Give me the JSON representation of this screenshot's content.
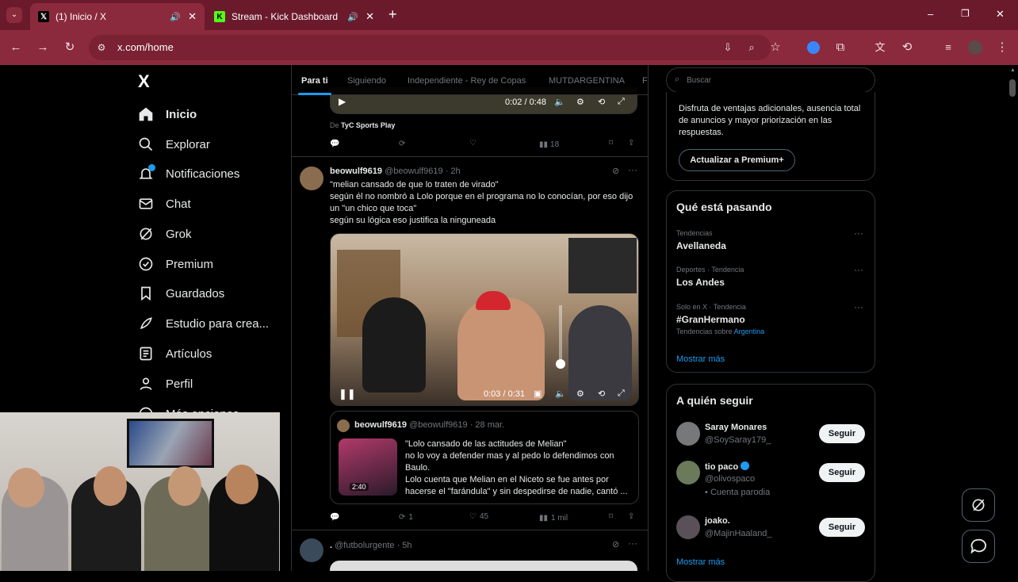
{
  "browser": {
    "tabs": [
      {
        "title": "(1) Inicio / X",
        "favicon": "x-logo"
      },
      {
        "title": "Stream - Kick Dashboard",
        "favicon": "kick-logo"
      }
    ],
    "new_tab": "+",
    "window": {
      "minimize": "–",
      "maximize": "❐",
      "close": "✕"
    },
    "url": "x.com/home",
    "accent": "#8c2a3d"
  },
  "nav": {
    "logo": "X",
    "items": [
      {
        "label": "Inicio",
        "icon": "home-icon"
      },
      {
        "label": "Explorar",
        "icon": "search-icon"
      },
      {
        "label": "Notificaciones",
        "icon": "bell-icon"
      },
      {
        "label": "Chat",
        "icon": "mail-icon"
      },
      {
        "label": "Grok",
        "icon": "grok-icon"
      },
      {
        "label": "Premium",
        "icon": "verified-icon"
      },
      {
        "label": "Guardados",
        "icon": "bookmark-icon"
      },
      {
        "label": "Estudio para crea...",
        "icon": "rocket-icon"
      },
      {
        "label": "Artículos",
        "icon": "article-icon"
      },
      {
        "label": "Perfil",
        "icon": "person-icon"
      },
      {
        "label": "Más opciones",
        "icon": "more-icon"
      }
    ]
  },
  "feed": {
    "tabs": [
      "Para ti",
      "Siguiendo",
      "Independiente - Rey de Copas",
      "MUTDARGENTINA",
      "Fu"
    ],
    "post0": {
      "time": "0:02 / 0:48",
      "from": "De",
      "source": "TyC Sports Play",
      "views": "18"
    },
    "post1": {
      "name": "beowulf9619",
      "handle": "@beowulf9619 · 2h",
      "text": [
        "\"melian cansado de que lo traten de virado\"",
        "según él no nombró a Lolo porque en el programa no lo conocían, por eso dijo un \"un chico que toca\"",
        "según su lógica eso justifica la ninguneada"
      ],
      "video_time": "0:03 / 0:31",
      "quote": {
        "name": "beowulf9619",
        "handle": "@beowulf9619 · 28 mar.",
        "thumb_time": "2:40",
        "text": "\"Lolo cansado de las actitudes de Melian\"\nno lo voy a defender mas y al pedo lo defendimos con Baulo.\nLolo cuenta que Melian en el Niceto se fue antes por hacerse el \"farándula\" y sin despedirse de nadie, cantó ..."
      },
      "retweets": "1",
      "likes": "45",
      "views": "1 mil"
    },
    "post2": {
      "name": ".",
      "handle": "@futbolurgente · 5h"
    }
  },
  "right": {
    "search_placeholder": "Buscar",
    "premium": {
      "text": "Disfruta de ventajas adicionales, ausencia total de anuncios y mayor priorización en las respuestas.",
      "button": "Actualizar a Premium+"
    },
    "trends": {
      "title": "Qué está pasando",
      "items": [
        {
          "category": "Tendencias",
          "name": "Avellaneda"
        },
        {
          "category": "Deportes · Tendencia",
          "name": "Los Andes"
        },
        {
          "category": "Solo en X · Tendencia",
          "name": "#GranHermano",
          "extra": "Tendencias sobre",
          "extra_link": "Argentina"
        }
      ],
      "more": "Mostrar más"
    },
    "follow": {
      "title": "A quién seguir",
      "items": [
        {
          "name": "Saray Monares",
          "handle": "@SoySaray179_",
          "button": "Seguir"
        },
        {
          "name": "tio paco",
          "handle": "@olivospaco",
          "badge": "Cuenta parodia",
          "button": "Seguir"
        },
        {
          "name": "joako.",
          "handle": "@MajinHaaland_",
          "button": "Seguir"
        }
      ],
      "more": "Mostrar más"
    }
  }
}
